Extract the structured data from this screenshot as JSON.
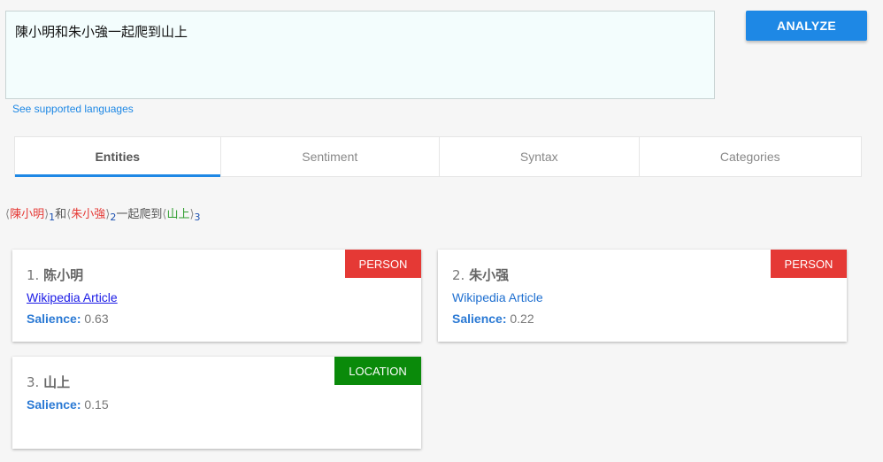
{
  "input": {
    "text": "陳小明和朱小強一起爬到山上"
  },
  "analyze_label": "ANALYZE",
  "langs_link": "See supported languages",
  "tabs": [
    {
      "label": "Entities",
      "active": true
    },
    {
      "label": "Sentiment",
      "active": false
    },
    {
      "label": "Syntax",
      "active": false
    },
    {
      "label": "Categories",
      "active": false
    }
  ],
  "annotated": {
    "open": "⟨",
    "close": "⟩",
    "e1": "陳小明",
    "n1": "1",
    "sep1": "和",
    "e2": "朱小強",
    "n2": "2",
    "sep2": "一起爬到",
    "e3": "山上",
    "n3": "3"
  },
  "entities": [
    {
      "index": "1.",
      "name": "陈小明",
      "type": "PERSON",
      "wiki": "Wikipedia Article",
      "salience_label": "Salience:",
      "salience": "0.63"
    },
    {
      "index": "2.",
      "name": "朱小强",
      "type": "PERSON",
      "wiki": "Wikipedia Article",
      "salience_label": "Salience:",
      "salience": "0.22"
    },
    {
      "index": "3.",
      "name": "山上",
      "type": "LOCATION",
      "salience_label": "Salience:",
      "salience": "0.15"
    }
  ],
  "colors": {
    "accent": "#1e88e5",
    "person": "#e53935",
    "location": "#0a8a0a"
  }
}
